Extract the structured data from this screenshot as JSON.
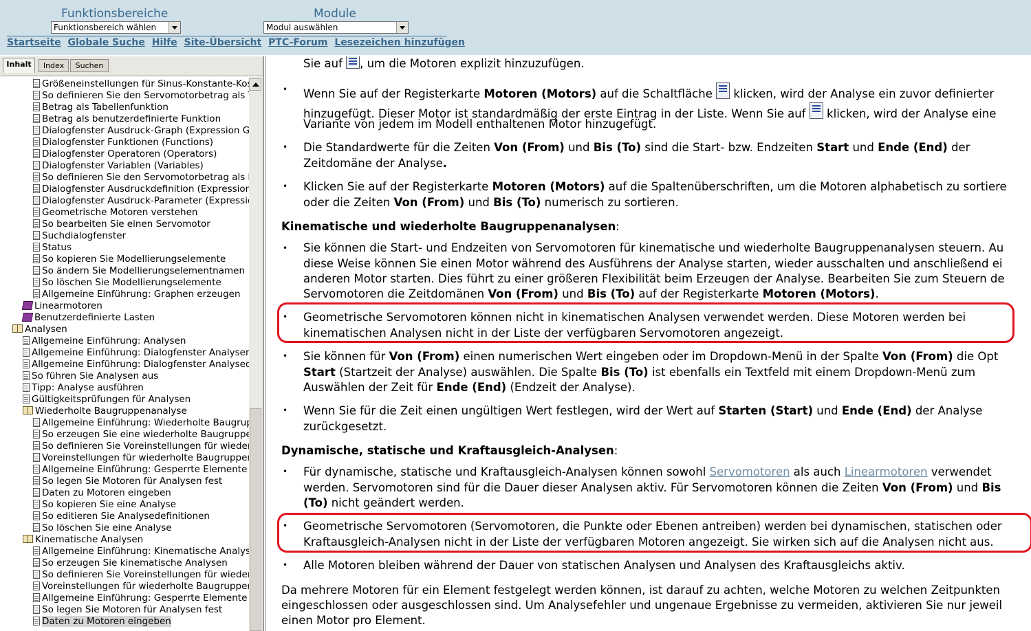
{
  "header": {
    "label_areas": "Funktionsbereiche",
    "label_modules": "Module",
    "select_area": "Funktionsbereich wählen",
    "select_module": "Modul auswählen",
    "nav": [
      "Startseite",
      "Globale Suche",
      "Hilfe",
      "Site-Übersicht",
      "PTC-Forum",
      "Lesezeichen hinzufügen"
    ]
  },
  "tabs": [
    "Inhalt",
    "Index",
    "Suchen"
  ],
  "tree": [
    {
      "text": "Größeneinstellungen für Sinus-Konstante-Kos",
      "icon": "doc-icon",
      "level": 2
    },
    {
      "text": "So definieren Sie den Servomotorbetrag als T",
      "icon": "doc-icon",
      "level": 2
    },
    {
      "text": "Betrag als Tabellenfunktion",
      "icon": "doc-icon",
      "level": 2
    },
    {
      "text": "Betrag als benutzerdefinierte Funktion",
      "icon": "doc-icon",
      "level": 2
    },
    {
      "text": "Dialogfenster Ausdruck-Graph (Expression Gr",
      "icon": "doc-icon",
      "level": 2
    },
    {
      "text": "Dialogfenster Funktionen (Functions)",
      "icon": "doc-icon",
      "level": 2
    },
    {
      "text": "Dialogfenster Operatoren (Operators)",
      "icon": "doc-icon",
      "level": 2
    },
    {
      "text": "Dialogfenster Variablen (Variables)",
      "icon": "doc-icon",
      "level": 2
    },
    {
      "text": "So definieren Sie den Servomotorbetrag als b",
      "icon": "doc-icon",
      "level": 2
    },
    {
      "text": "Dialogfenster Ausdruckdefinition (Expression",
      "icon": "doc-icon",
      "level": 2
    },
    {
      "text": "Dialogfenster Ausdruck-Parameter (Expressio",
      "icon": "doc-icon",
      "level": 2
    },
    {
      "text": "Geometrische Motoren verstehen",
      "icon": "doc-icon",
      "level": 2
    },
    {
      "text": "So bearbeiten Sie einen Servomotor",
      "icon": "doc-icon",
      "level": 2
    },
    {
      "text": "Suchdialogfenster",
      "icon": "doc-icon",
      "level": 2
    },
    {
      "text": "Status",
      "icon": "doc-icon",
      "level": 2
    },
    {
      "text": "So kopieren Sie Modellierungselemente",
      "icon": "doc-icon",
      "level": 2
    },
    {
      "text": "So ändern Sie Modellierungselementnamen",
      "icon": "doc-icon",
      "level": 2
    },
    {
      "text": "So löschen Sie Modellierungselemente",
      "icon": "doc-icon",
      "level": 2
    },
    {
      "text": "Allgemeine Einführung: Graphen erzeugen",
      "icon": "doc-icon",
      "level": 2
    },
    {
      "text": "Linearmotoren",
      "icon": "book-icon",
      "level": 1
    },
    {
      "text": "Benutzerdefinierte Lasten",
      "icon": "book-icon",
      "level": 1
    },
    {
      "text": "Analysen",
      "icon": "book-open-icon",
      "level": 0
    },
    {
      "text": "Allgemeine Einführung: Analysen",
      "icon": "doc-icon",
      "level": 1
    },
    {
      "text": "Allgemeine Einführung: Dialogfenster Analysen (",
      "icon": "doc-icon",
      "level": 1
    },
    {
      "text": "Allgemeine Einführung: Dialogfenster Analysede",
      "icon": "doc-icon",
      "level": 1
    },
    {
      "text": "So führen Sie Analysen aus",
      "icon": "doc-icon",
      "level": 1
    },
    {
      "text": "Tipp: Analyse ausführen",
      "icon": "doc-icon",
      "level": 1
    },
    {
      "text": "Gültigkeitsprüfungen für Analysen",
      "icon": "doc-icon",
      "level": 1
    },
    {
      "text": "Wiederholte Baugruppenanalyse",
      "icon": "book-open-icon",
      "level": 1
    },
    {
      "text": "Allgemeine Einführung: Wiederholte Baugrupp",
      "icon": "doc-icon",
      "level": 2
    },
    {
      "text": "So erzeugen Sie eine wiederholte Baugruppen",
      "icon": "doc-icon",
      "level": 2
    },
    {
      "text": "So definieren Sie Voreinstellungen für wiederh",
      "icon": "doc-icon",
      "level": 2
    },
    {
      "text": "Voreinstellungen für wiederholte Baugruppen-",
      "icon": "doc-icon",
      "level": 2
    },
    {
      "text": "Allgemeine Einführung: Gesperrte Elemente fü",
      "icon": "doc-icon",
      "level": 2
    },
    {
      "text": "So legen Sie Motoren für Analysen fest",
      "icon": "doc-icon",
      "level": 2
    },
    {
      "text": "Daten zu Motoren eingeben",
      "icon": "doc-icon",
      "level": 2
    },
    {
      "text": "So kopieren Sie eine Analyse",
      "icon": "doc-icon",
      "level": 2
    },
    {
      "text": "So editieren Sie Analysedefinitionen",
      "icon": "doc-icon",
      "level": 2
    },
    {
      "text": "So löschen Sie eine Analyse",
      "icon": "doc-icon",
      "level": 2
    },
    {
      "text": "Kinematische Analysen",
      "icon": "book-open-icon",
      "level": 1
    },
    {
      "text": "Allgemeine Einführung: Kinematische Analyse",
      "icon": "doc-icon",
      "level": 2
    },
    {
      "text": "So erzeugen Sie kinematische Analysen",
      "icon": "doc-icon",
      "level": 2
    },
    {
      "text": "So definieren Sie Voreinstellungen für wiederh",
      "icon": "doc-icon",
      "level": 2
    },
    {
      "text": "Voreinstellungen für wiederholte Baugruppen-",
      "icon": "doc-icon",
      "level": 2
    },
    {
      "text": "Allgemeine Einführung: Gesperrte Elemente fü",
      "icon": "doc-icon",
      "level": 2
    },
    {
      "text": "So legen Sie Motoren für Analysen fest",
      "icon": "doc-icon",
      "level": 2
    },
    {
      "text": "Daten zu Motoren eingeben",
      "icon": "doc-icon",
      "level": 2,
      "selected": true
    }
  ],
  "content": {
    "l0_a": "Sie auf ",
    "l0_b": ", um die Motoren explizit hinzuzufügen.",
    "b1_a": "Wenn Sie auf der Registerkarte ",
    "b1_b": "Motoren (Motors)",
    "b1_c": " auf die Schaltfläche ",
    "b1_d": " klicken, wird der Analyse ein zuvor definierter",
    "b1_e": "hinzugefügt. Dieser Motor ist standardmäßig der erste Eintrag in der Liste. Wenn Sie auf ",
    "b1_f": " klicken, wird der Analyse eine",
    "b1_g": "Variante von jedem im Modell enthaltenen Motor hinzugefügt.",
    "b2_a": "Die Standardwerte für die Zeiten ",
    "b2_b": "Von (From)",
    "b2_c": " und ",
    "b2_d": "Bis (To)",
    "b2_e": " sind die Start- bzw. Endzeiten ",
    "b2_f": "Start",
    "b2_g": " und ",
    "b2_h": "Ende (End)",
    "b2_i": " der",
    "b2_j": "Zeitdomäne der Analyse",
    "b2_k": ".",
    "b3_a": "Klicken Sie auf der Registerkarte ",
    "b3_b": "Motoren (Motors)",
    "b3_c": " auf die Spaltenüberschriften, um die Motoren alphabetisch zu sortiere",
    "b3_d": "oder die Zeiten ",
    "b3_e": "Von (From)",
    "b3_f": " und ",
    "b3_g": "Bis (To)",
    "b3_h": " numerisch zu sortieren.",
    "h1": "Kinematische und wiederholte Baugruppenanalysen",
    "h1_colon": ":",
    "b4_l1": "Sie können die Start- und Endzeiten von Servomotoren für kinematische und wiederholte Baugruppenanalysen steuern. Au",
    "b4_l2": "diese Weise können Sie einen Motor während des Ausführens der Analyse starten, wieder ausschalten und anschließend ei",
    "b4_l3": "anderen Motor starten. Dies führt zu einer größeren Flexibilität beim Erzeugen der Analyse. Bearbeiten Sie zum Steuern de",
    "b4_l4a": "Servomotoren die Zeitdomänen ",
    "b4_l4b": "Von (From)",
    "b4_l4c": " und ",
    "b4_l4d": "Bis (To)",
    "b4_l4e": " auf der Registerkarte ",
    "b4_l4f": "Motoren (Motors)",
    "b4_l4g": ".",
    "b5_l1": "Geometrische Servomotoren können nicht in kinematischen Analysen verwendet werden. Diese Motoren werden bei",
    "b5_l2": "kinematischen Analysen nicht in der Liste der verfügbaren Servomotoren angezeigt.",
    "b6_a": "Sie können für ",
    "b6_b": "Von (From)",
    "b6_c": " einen numerischen Wert eingeben oder im Dropdown-Menü in der Spalte ",
    "b6_d": "Von (From)",
    "b6_e": " die Opt",
    "b6_f": "Start",
    "b6_g": " (Startzeit der Analyse) auswählen. Die Spalte ",
    "b6_h": "Bis (To)",
    "b6_i": " ist ebenfalls ein Textfeld mit einem Dropdown-Menü zum",
    "b6_j": "Auswählen der Zeit für ",
    "b6_k": "Ende (End)",
    "b6_l": " (Endzeit der Analyse).",
    "b7_a": "Wenn Sie für die Zeit einen ungültigen Wert festlegen, wird der Wert auf ",
    "b7_b": "Starten (Start)",
    "b7_c": " und ",
    "b7_d": "Ende (End)",
    "b7_e": " der Analyse",
    "b7_f": "zurückgesetzt.",
    "h2": "Dynamische, statische und Kraftausgleich-Analysen",
    "h2_colon": ":",
    "b8_a": "Für dynamische, statische und Kraftausgleich-Analysen können sowohl ",
    "b8_link1": "Servomotoren",
    "b8_b": " als auch ",
    "b8_link2": "Linearmotoren",
    "b8_c": " verwendet",
    "b8_d": "werden. Servomotoren sind für die Dauer dieser Analysen aktiv. Für Servomotoren können die Zeiten ",
    "b8_e": "Von (From)",
    "b8_f": " und ",
    "b8_g": "Bis",
    "b8_h": "(To)",
    "b8_i": " nicht geändert werden.",
    "b9_l1": "Geometrische Servomotoren (Servomotoren, die Punkte oder Ebenen antreiben) werden bei dynamischen, statischen oder",
    "b9_l2": "Kraftausgleich-Analysen nicht in der Liste der verfügbaren Motoren angezeigt. Sie wirken sich auf die Analysen nicht aus.",
    "b10": "Alle Motoren bleiben während der Dauer von statischen Analysen und Analysen des Kraftausgleichs aktiv.",
    "p1_l1": "Da mehrere Motoren für ein Element festgelegt werden können, ist darauf zu achten, welche Motoren zu welchen Zeitpunkten",
    "p1_l2": "eingeschlossen oder ausgeschlossen sind. Um Analysefehler und ungenaue Ergebnisse zu vermeiden, aktivieren Sie nur jeweil",
    "p1_l3": "einen Motor pro Element."
  },
  "colors": {
    "header_bg": "#cfe0e9",
    "nav_link": "#3a6a8e",
    "highlight_box": "#e0141e",
    "content_link": "#6e8ca4"
  }
}
